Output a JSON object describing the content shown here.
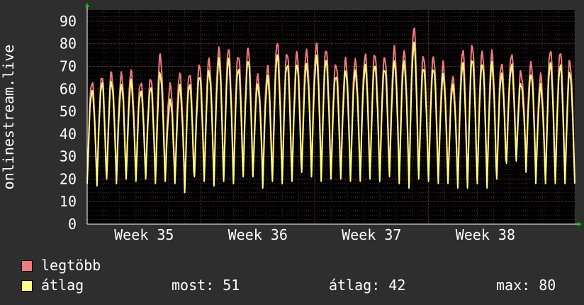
{
  "chart_data": {
    "type": "line",
    "ylabel": "onlinestream.live",
    "ylim": [
      0,
      95
    ],
    "yticks": [
      0,
      10,
      20,
      30,
      40,
      50,
      60,
      70,
      80,
      90
    ],
    "x_ticks": [
      {
        "label": "Week 35",
        "day": 3.5
      },
      {
        "label": "Week 36",
        "day": 10.5
      },
      {
        "label": "Week 37",
        "day": 17.5
      },
      {
        "label": "Week 38",
        "day": 24.5
      }
    ],
    "x_range_days": [
      0,
      30
    ],
    "grid": true,
    "series": [
      {
        "name": "legtöbb",
        "color": "#f07a80",
        "daily_peaks": [
          64,
          65,
          67,
          67,
          67,
          64,
          64,
          75,
          62,
          66,
          68,
          70,
          73,
          78,
          77,
          76,
          77,
          66,
          70,
          80,
          77,
          75,
          77,
          80,
          77,
          72,
          72,
          73,
          75,
          75,
          75,
          77,
          77,
          87,
          74,
          75,
          70,
          66,
          77,
          79,
          77,
          75,
          72,
          75,
          67,
          72,
          65,
          78,
          76,
          72
        ],
        "daily_lows": [
          20,
          19,
          22,
          20,
          22,
          21,
          22,
          20,
          21,
          20,
          15,
          23,
          21,
          19,
          21,
          20,
          23,
          23,
          18,
          21,
          20,
          21,
          25,
          23,
          21,
          22,
          22,
          21,
          21,
          22,
          21,
          23,
          20,
          18,
          22,
          21,
          20,
          20,
          17,
          17,
          20,
          18,
          22,
          29,
          30,
          25,
          20,
          20,
          20,
          20
        ]
      },
      {
        "name": "átlag",
        "color": "#ffff80",
        "daily_peaks": [
          60,
          62,
          63,
          62,
          62,
          60,
          60,
          67,
          55,
          60,
          63,
          65,
          68,
          73,
          72,
          70,
          72,
          62,
          65,
          74,
          72,
          70,
          71,
          74,
          72,
          67,
          67,
          68,
          70,
          70,
          70,
          71,
          72,
          80,
          69,
          70,
          65,
          62,
          71,
          73,
          72,
          70,
          67,
          70,
          62,
          67,
          60,
          72,
          70,
          67
        ],
        "daily_lows": [
          18,
          17,
          20,
          18,
          20,
          19,
          20,
          18,
          19,
          18,
          14,
          21,
          19,
          17,
          19,
          18,
          21,
          21,
          16,
          19,
          18,
          19,
          23,
          21,
          19,
          20,
          20,
          19,
          19,
          20,
          19,
          21,
          18,
          16,
          20,
          19,
          18,
          18,
          16,
          16,
          18,
          16,
          20,
          27,
          28,
          23,
          18,
          18,
          18,
          18
        ]
      }
    ]
  },
  "legend": {
    "max_label": "legtöbb",
    "avg_label": "átlag",
    "max_color": "#f07a80",
    "avg_color": "#ffff80",
    "now_text": "most: 51",
    "avg_text": "átlag: 42",
    "max_text": "max: 80"
  }
}
